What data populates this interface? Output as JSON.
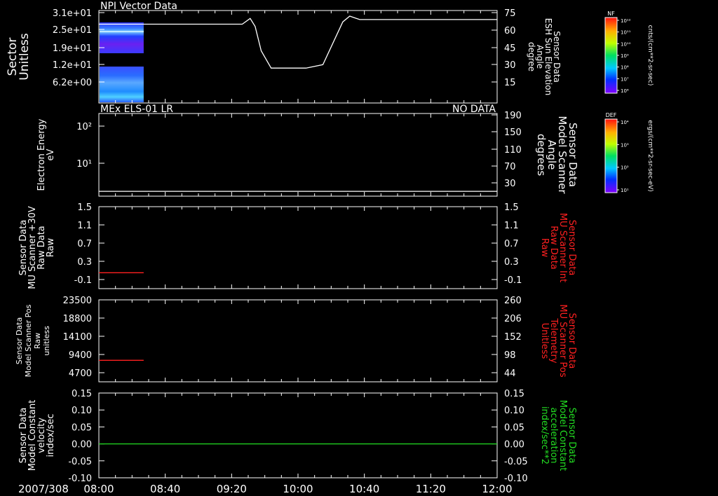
{
  "date_label": "2007/308",
  "x_ticks": [
    "08:00",
    "08:40",
    "09:20",
    "10:00",
    "10:40",
    "11:20",
    "12:00"
  ],
  "colors": {
    "bg": "#000000",
    "axis": "#ffffff",
    "red": "#ff2020",
    "green": "#22dd22"
  },
  "colorbars": [
    {
      "label": "NF",
      "units": "cnts/(cm**2-sr-sec)",
      "ticks": [
        "10¹²",
        "10¹¹",
        "10¹⁰",
        "10⁹",
        "10⁸",
        "10⁷",
        "10⁶"
      ]
    },
    {
      "label": "DEF",
      "units": "ergs/(cm**2-sr-sec-eV)",
      "ticks": [
        "10⁴",
        "10³",
        "10²",
        "10¹"
      ]
    }
  ],
  "chart_data": [
    {
      "type": "heatmap",
      "title": "NPI Vector Data",
      "right_title": "",
      "ylabel": [
        "Sector",
        "Unitless"
      ],
      "yticks": [
        "3.1e+01",
        "2.5e+01",
        "1.9e+01",
        "1.2e+01",
        "6.2e+00"
      ],
      "y2label": [
        "Sensor Data",
        "ESH Sun Elevation",
        "Angle",
        "degree"
      ],
      "y2ticks": [
        "75",
        "60",
        "45",
        "30",
        "15"
      ],
      "y2lim": [
        3,
        75
      ],
      "overlay": {
        "name": "ESH Sun Elevation Angle",
        "t": [
          0,
          1.44,
          1.52,
          1.57,
          1.63,
          1.73,
          2.08,
          2.25,
          2.45,
          2.52,
          2.62,
          4.0
        ],
        "values": [
          65,
          65,
          70,
          63,
          42,
          27,
          27,
          30,
          67,
          72,
          69,
          69
        ]
      },
      "heat_extent_hours": [
        0,
        0.45
      ]
    },
    {
      "type": "line",
      "title": "MEx ELS-01 LR",
      "right_title": "NO DATA",
      "ylabel": [
        "Electron Energy",
        "eV"
      ],
      "yticks": [
        "10²",
        "10¹"
      ],
      "y2label": [
        "Sensor Data",
        "Model Scanner",
        "Angle",
        "degrees"
      ],
      "y2ticks": [
        "190",
        "150",
        "110",
        "70",
        "30"
      ],
      "y2lim": [
        1,
        190
      ],
      "series": [
        {
          "name": "Model Scanner Angle",
          "t": [
            0,
            4
          ],
          "values": [
            10,
            10
          ],
          "color": "white"
        }
      ]
    },
    {
      "type": "line",
      "ylabel": [
        "Sensor Data",
        "MU Scanner +30V",
        "Raw Data",
        "Raw"
      ],
      "yticks": [
        "1.5",
        "1.1",
        "0.7",
        "0.3",
        "-0.1"
      ],
      "ylim": [
        -0.3,
        1.5
      ],
      "y2label": [
        "Sensor Data",
        "MU Scanner Int",
        "Raw Data",
        "Raw"
      ],
      "y2ticks": [
        "1.5",
        "1.1",
        "0.7",
        "0.3",
        "-0.1"
      ],
      "series": [
        {
          "name": "MU Scanner Int",
          "t": [
            0,
            0.45
          ],
          "values": [
            0.05,
            0.05
          ],
          "color": "red"
        }
      ]
    },
    {
      "type": "line",
      "ylabel": [
        "Sensor Data",
        "Model Scanner Pos",
        "Raw",
        "unitless"
      ],
      "yticks": [
        "23500",
        "18800",
        "14100",
        "9400",
        "4700"
      ],
      "ylim": [
        500,
        23500
      ],
      "y2label": [
        "Sensor Data",
        "MU Scanner Pos",
        "Telemetry",
        "Unitless"
      ],
      "y2ticks": [
        "260",
        "206",
        "152",
        "98",
        "44"
      ],
      "series": [
        {
          "name": "MU Scanner Pos",
          "t": [
            0,
            0.45
          ],
          "values": [
            7900,
            7900
          ],
          "color": "red"
        }
      ]
    },
    {
      "type": "line",
      "ylabel": [
        "Sensor Data",
        "Model Constant",
        "velocity",
        "index/sec"
      ],
      "yticks": [
        "0.15",
        "0.10",
        "0.05",
        "0.00",
        "-0.05",
        "-0.10"
      ],
      "ylim": [
        -0.1,
        0.15
      ],
      "y2label": [
        "Sensor Data",
        "Model Constant",
        "acceleration",
        "index/sec**2"
      ],
      "y2ticks": [
        "0.15",
        "0.10",
        "0.05",
        "0.00",
        "-0.05",
        "-0.10"
      ],
      "series": [
        {
          "name": "Model Constant acceleration",
          "t": [
            0,
            4
          ],
          "values": [
            0,
            0
          ],
          "color": "green"
        }
      ]
    }
  ]
}
